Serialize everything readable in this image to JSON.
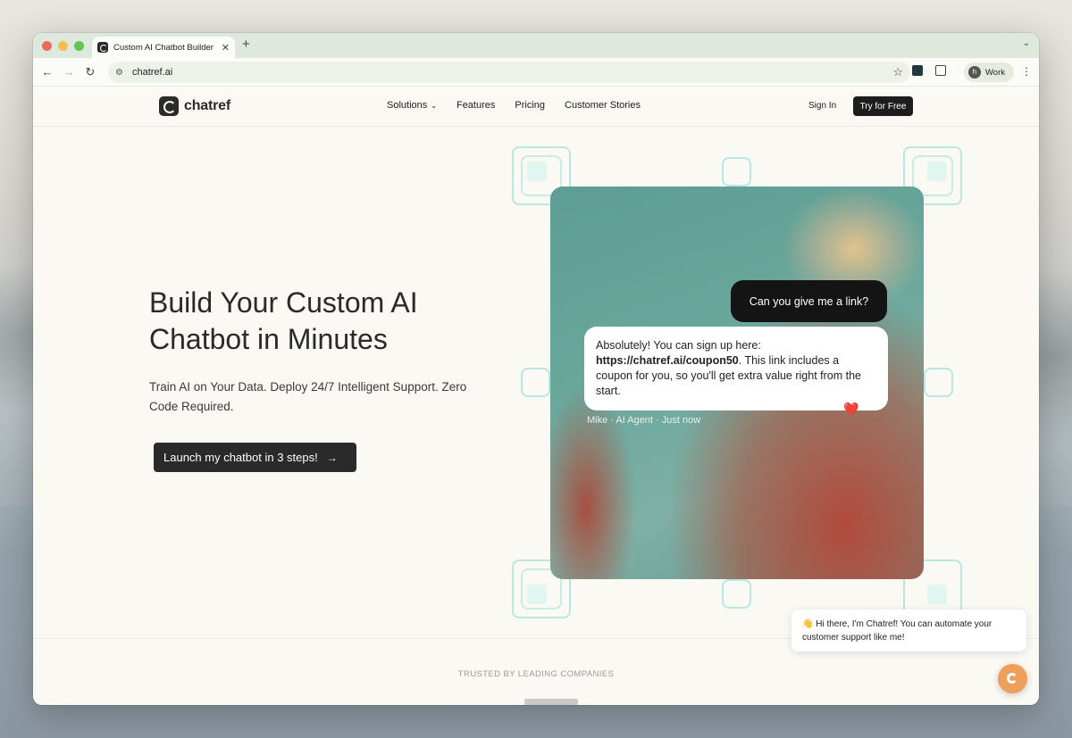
{
  "browser": {
    "tab_title": "Custom AI Chatbot Builder | C",
    "tab_close": "✕",
    "new_tab": "+",
    "url": "chatref.ai",
    "profile_initial": "h",
    "profile_label": "Work"
  },
  "nav": {
    "brand": "chatref",
    "items": [
      "Solutions",
      "Features",
      "Pricing",
      "Customer Stories"
    ],
    "sign_in": "Sign In",
    "try_free": "Try for Free"
  },
  "hero": {
    "title": "Build Your Custom AI Chatbot in Minutes",
    "subtitle": "Train AI on Your Data. Deploy 24/7 Intelligent Support. Zero Code Required.",
    "cta": "Launch my chatbot in 3 steps!",
    "cta_arrow": "→"
  },
  "chat_demo": {
    "user_message": "Can you give me a link?",
    "ai_message_pre": "Absolutely! You can sign up here: ",
    "ai_message_link": "https://chatref.ai/coupon50",
    "ai_message_post": ". This link includes a coupon for you, so you'll get extra value right from the start.",
    "reaction": "❤️",
    "meta": "Mike · AI Agent · Just now"
  },
  "trusted": {
    "label": "TRUSTED BY LEADING COMPANIES"
  },
  "widget": {
    "message": "👋 Hi there, I'm Chatref! You can automate your customer support like me!"
  },
  "colors": {
    "accent": "#ee9f5a",
    "dark": "#1d1d1d",
    "deco": "#b9e7e1"
  }
}
